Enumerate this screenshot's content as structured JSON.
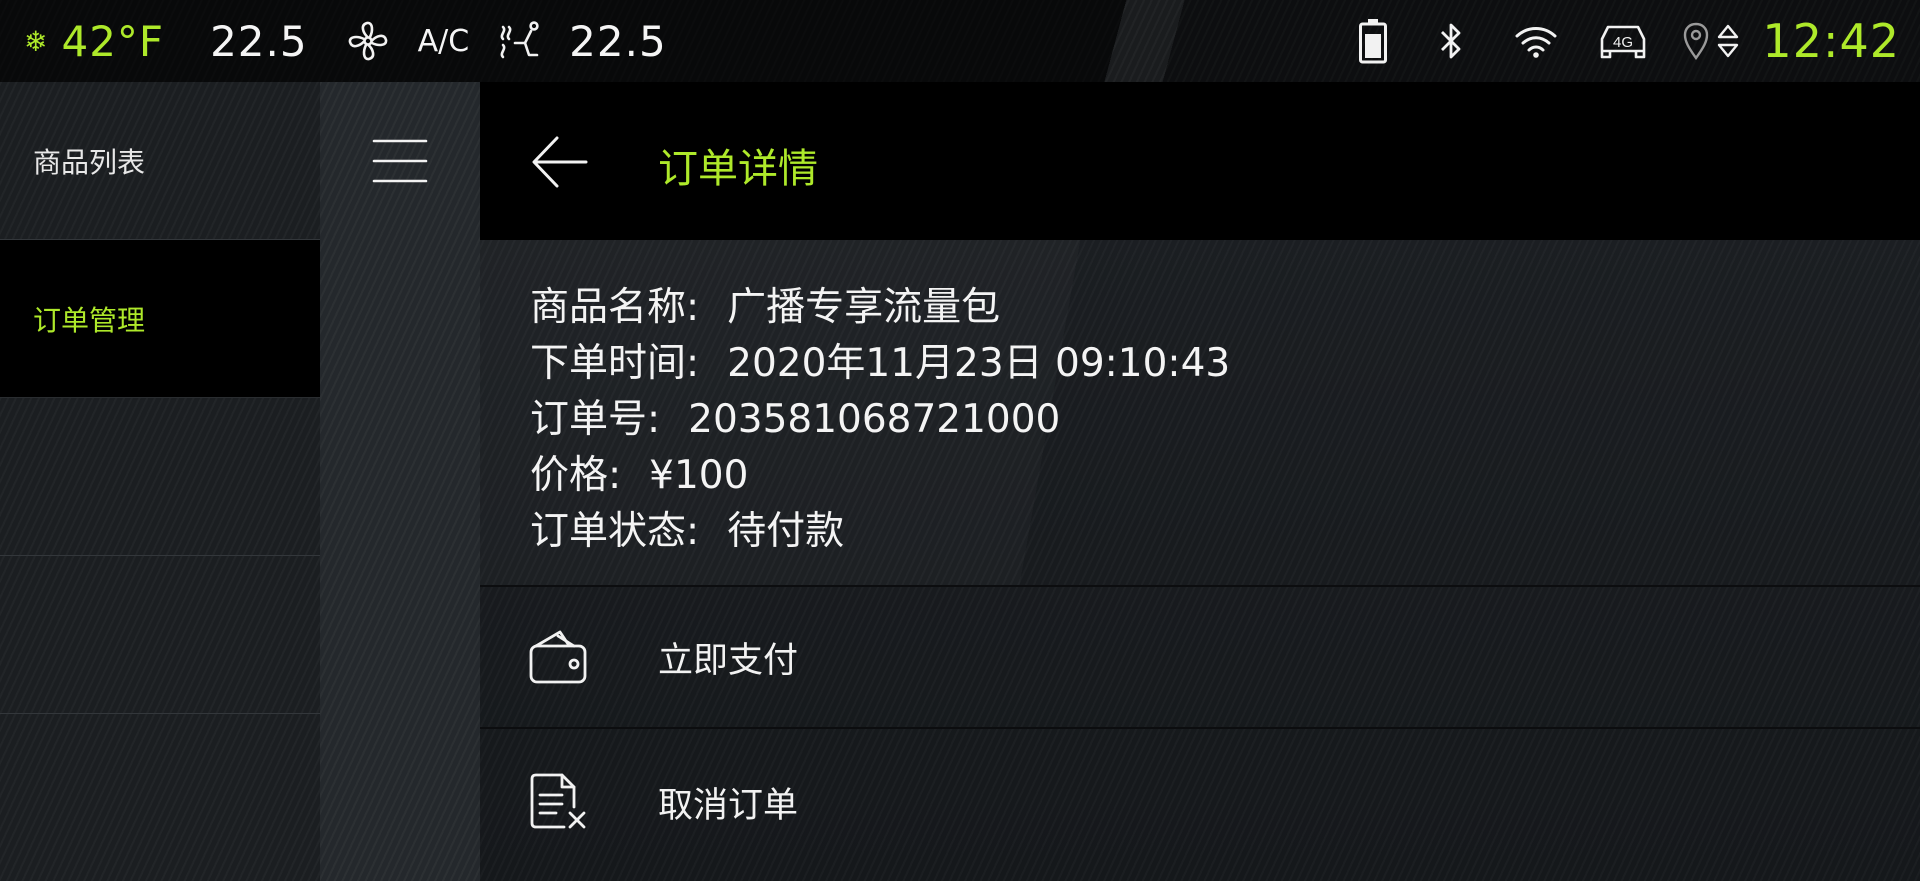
{
  "status_bar": {
    "outside_temp": "42°F",
    "driver_temp": "22.5",
    "ac_label": "A/C",
    "passenger_temp": "22.5",
    "clock": "12:42",
    "network": "4G",
    "icons": [
      "snowflake-icon",
      "fan-icon",
      "seat-heat-icon",
      "battery-icon",
      "bluetooth-icon",
      "wifi-icon",
      "car-4g-icon",
      "location-icon",
      "sort-arrows-icon"
    ]
  },
  "sidebar": {
    "items": [
      {
        "label": "商品列表"
      },
      {
        "label": "订单管理"
      }
    ]
  },
  "header": {
    "title": "订单详情"
  },
  "order": {
    "name_label": "商品名称:",
    "name_value": "广播专享流量包",
    "time_label": "下单时间:",
    "time_value": "2020年11月23日 09:10:43",
    "number_label": "订单号:",
    "number_value": "203581068721000",
    "price_label": "价格:",
    "price_value": "¥100",
    "status_label": "订单状态:",
    "status_value": "待付款"
  },
  "actions": {
    "pay_label": "立即支付",
    "cancel_label": "取消订单"
  },
  "colors": {
    "accent": "#aee92a",
    "background": "#1b1e21",
    "header_bg": "#000000"
  }
}
